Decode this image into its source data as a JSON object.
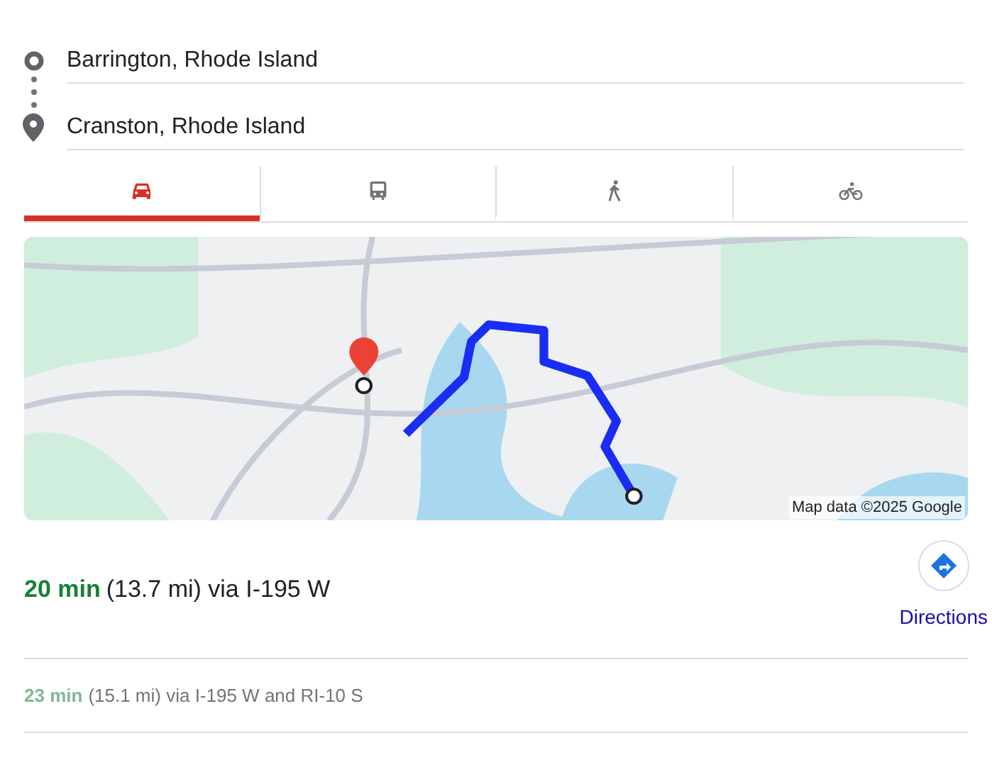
{
  "origin": {
    "value": "Barrington, Rhode Island"
  },
  "destination": {
    "value": "Cranston, Rhode Island"
  },
  "modes": [
    {
      "kind": "car",
      "selected": true
    },
    {
      "kind": "transit",
      "selected": false
    },
    {
      "kind": "walk",
      "selected": false
    },
    {
      "kind": "bike",
      "selected": false
    }
  ],
  "map": {
    "kind": "picture",
    "attribution": "Map data ©2025 Google"
  },
  "routes": [
    {
      "kind": "primary",
      "time": "20 min",
      "details": "(13.7 mi) via I-195 W"
    },
    {
      "kind": "alternate",
      "time": "23 min",
      "details": "(15.1 mi) via I-195 W and RI-10 S"
    }
  ],
  "directions_button": {
    "label": "Directions"
  }
}
